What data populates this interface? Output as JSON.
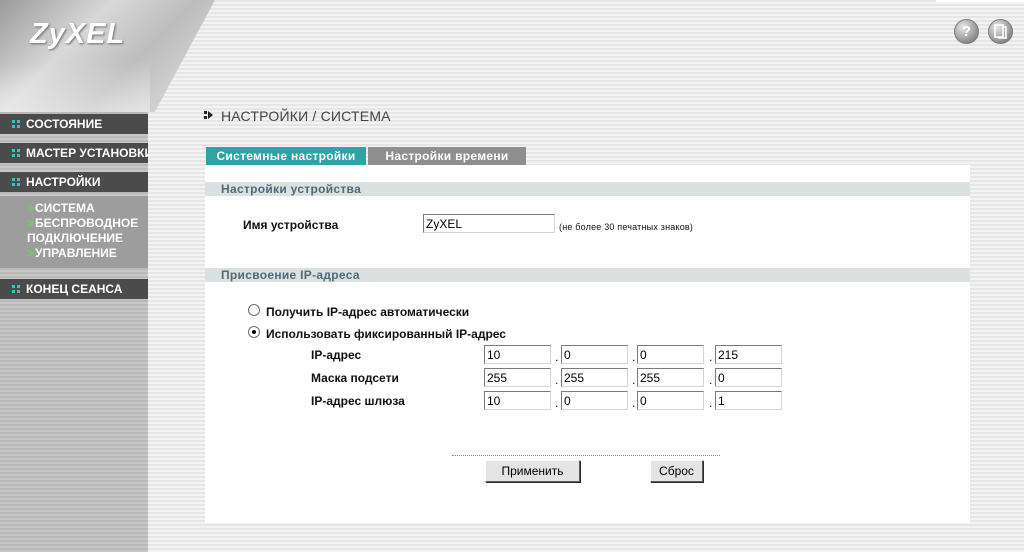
{
  "brand": {
    "logo_text": "ZyXEL"
  },
  "header": {
    "help_icon": "question-mark-icon",
    "about_icon": "info-icon"
  },
  "sidebar": {
    "items": [
      {
        "label": "СОСТОЯНИЕ"
      },
      {
        "label": "МАСТЕР УСТАНОВКИ"
      },
      {
        "label": "НАСТРОЙКИ"
      },
      {
        "label": "КОНЕЦ СЕАНСА"
      }
    ],
    "submenu": [
      {
        "label": "СИСТЕМА"
      },
      {
        "label": "БЕСПРОВОДНОЕ",
        "label2": "ПОДКЛЮЧЕНИЕ"
      },
      {
        "label": "УПРАВЛЕНИЕ"
      }
    ],
    "accent_color": "#36c3c8",
    "arrow_color": "#6ad15a"
  },
  "page": {
    "title": "НАСТРОЙКИ / СИСТЕМА"
  },
  "tabs": [
    {
      "label": "Системные настройки",
      "active": true
    },
    {
      "label": "Настройки времени",
      "active": false
    }
  ],
  "device": {
    "section_title": "Настройки устройства",
    "name_label": "Имя устройства",
    "name_value": "ZyXEL",
    "name_hint": "(не более 30 печатных знаков)"
  },
  "ip": {
    "section_title": "Присвоение IP-адреса",
    "option_auto": "Получить IP-адрес автоматически",
    "option_fixed": "Использовать фиксированный IP-адрес",
    "selected": "fixed",
    "separator": ".",
    "address": {
      "label": "IP-адрес",
      "octets": [
        "10",
        "0",
        "0",
        "215"
      ]
    },
    "mask": {
      "label": "Маска подсети",
      "octets": [
        "255",
        "255",
        "255",
        "0"
      ]
    },
    "gateway": {
      "label": "IP-адрес шлюза",
      "octets": [
        "10",
        "0",
        "0",
        "1"
      ]
    }
  },
  "buttons": {
    "apply": "Применить",
    "reset": "Сброс"
  },
  "colors": {
    "tab_active": "#2fa3a7",
    "tab_inactive": "#8f8f8f",
    "menu_bg": "#4b4b4b",
    "section_bar": "#dbe1e1",
    "section_text": "#4e6a7a"
  }
}
